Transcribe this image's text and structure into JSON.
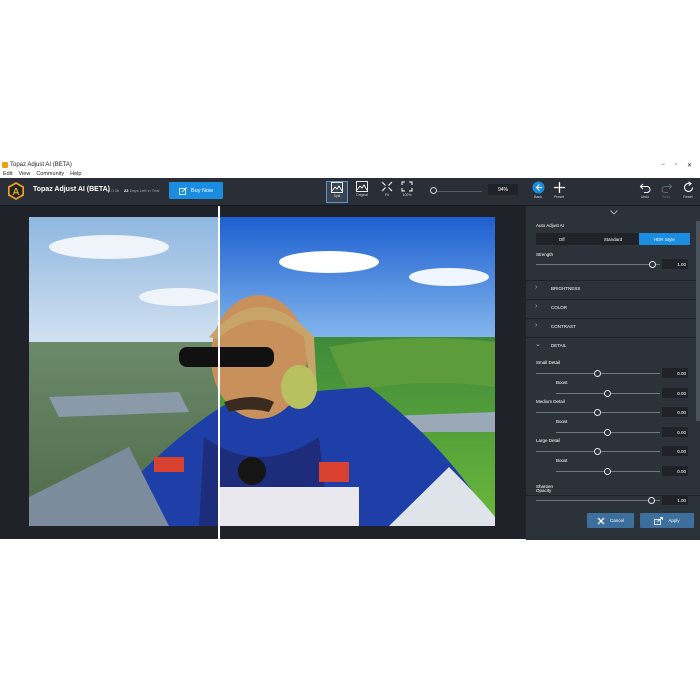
{
  "window": {
    "title": "Topaz Adjust AI (BETA)",
    "controls": [
      "−",
      "▫",
      "✕"
    ]
  },
  "menu": [
    "Edit",
    "View",
    "Community",
    "Help"
  ],
  "toolbar": {
    "app_name": "Topaz Adjust AI (BETA)",
    "version": "v0.0.3b",
    "trial_days": "22",
    "trial_text": "Days Left in Trial",
    "buy_label": "Buy Now",
    "views": [
      {
        "label": "Split",
        "active": true
      },
      {
        "label": "Original",
        "active": false
      },
      {
        "label": "Fit",
        "active": false
      },
      {
        "label": "100%",
        "active": false
      }
    ],
    "zoom_value": "94%",
    "back_label": "Back",
    "preset_label": "Preset",
    "undo_label": "Undo",
    "redo_label": "Redo",
    "reset_label": "Reset"
  },
  "panel": {
    "auto_title": "Auto Adjust AI",
    "modes": [
      "Off",
      "Standard",
      "HDR Style"
    ],
    "selected_mode": "HDR Style",
    "strength_label": "Strength",
    "strength_value": "1.00",
    "sections": [
      "BRIGHTNESS",
      "COLOR",
      "CONTRAST",
      "DETAIL"
    ],
    "detail": {
      "small_label": "Small Detail",
      "small_value": "0.00",
      "small_boost_label": "Boost",
      "small_boost_value": "0.00",
      "medium_label": "Medium Detail",
      "medium_value": "0.00",
      "medium_boost_label": "Boost",
      "medium_boost_value": "0.00",
      "large_label": "Large Detail",
      "large_value": "0.00",
      "large_boost_label": "Boost",
      "large_boost_value": "0.00",
      "sharpen_label": "Sharpen"
    },
    "opacity_label": "Opacity",
    "opacity_value": "1.00",
    "cancel_label": "Cancel",
    "apply_label": "Apply"
  },
  "colors": {
    "accent": "#1a8de0",
    "panel_bg": "#2c323a",
    "app_bg": "#1f2329"
  }
}
